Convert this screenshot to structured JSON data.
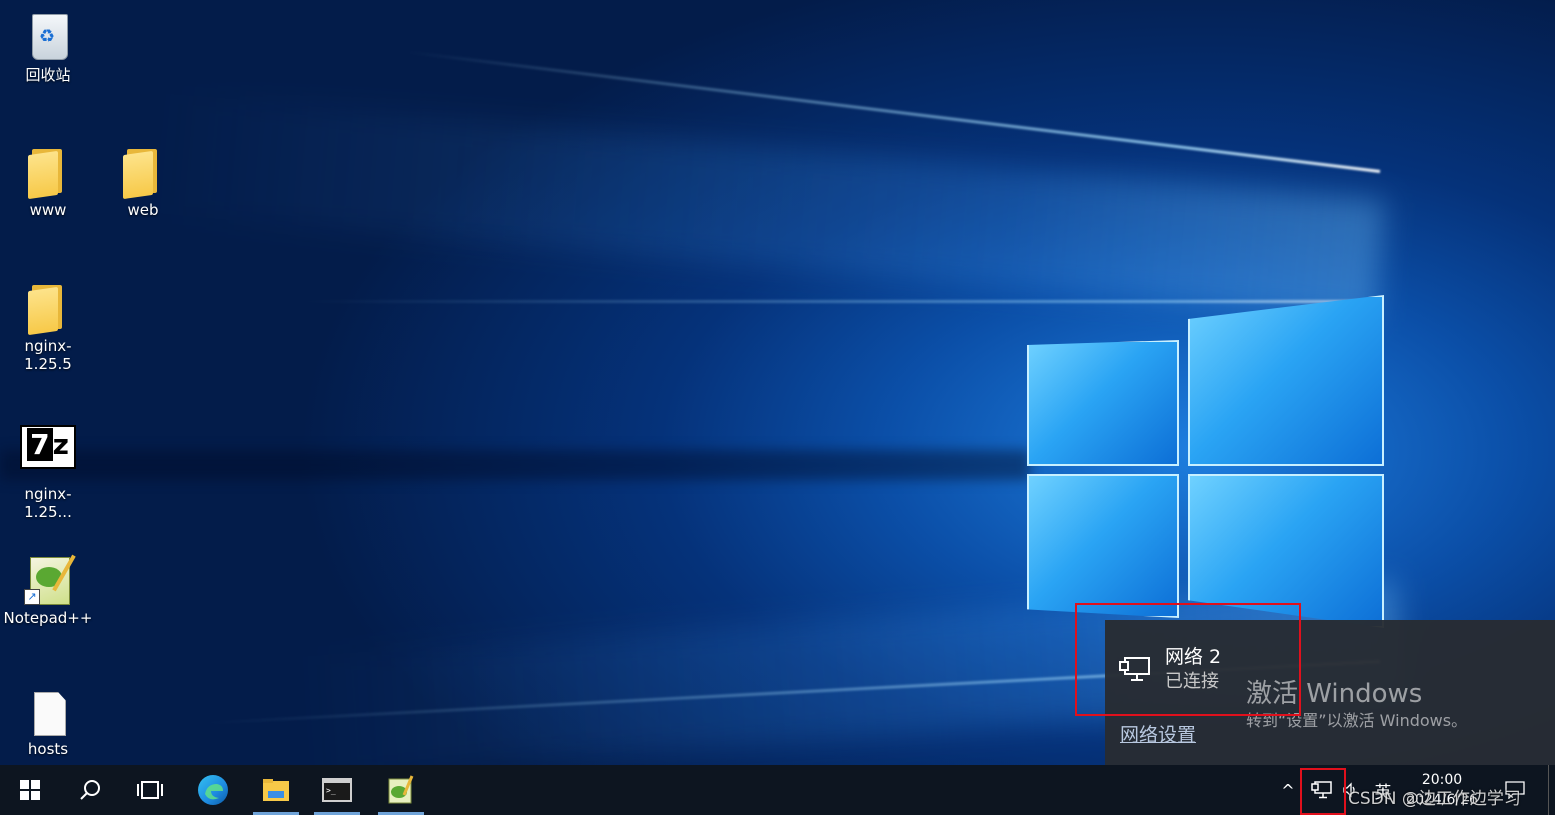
{
  "desktop_icons": [
    {
      "label": "回收站",
      "icon": "recycle-bin-icon"
    },
    {
      "label": "www",
      "icon": "folder-icon"
    },
    {
      "label": "web",
      "icon": "folder-icon"
    },
    {
      "label": "nginx-1.25.5",
      "icon": "folder-icon"
    },
    {
      "label": "nginx-1.25...",
      "icon": "7zip-archive-icon"
    },
    {
      "label": "Notepad++",
      "icon": "notepad-plus-plus-shortcut-icon"
    },
    {
      "label": "hosts",
      "icon": "file-icon"
    }
  ],
  "network_flyout": {
    "network_name": "网络  2",
    "status": "已连接",
    "settings_link": "网络设置"
  },
  "activation": {
    "title": "激活 Windows",
    "subtitle": "转到“设置”以激活 Windows。"
  },
  "taskbar": {
    "pinned": [
      "start-icon",
      "search-icon",
      "task-view-icon",
      "edge-icon",
      "file-explorer-icon",
      "terminal-icon",
      "notepad-plus-plus-icon"
    ],
    "tray": {
      "chevron": "^",
      "ime": "英",
      "time": "20:00",
      "date": "2024/6/26"
    }
  },
  "watermark": "CSDN @边工作边学习",
  "colors": {
    "highlight_box": "#e0101c",
    "flyout_bg": "#282c32",
    "taskbar_bg": "#0d1520"
  }
}
